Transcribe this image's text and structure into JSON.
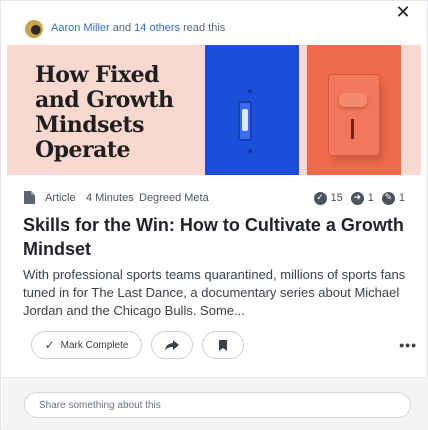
{
  "header": {
    "reader_name": "Aaron Miller",
    "reader_connector": "and",
    "others_link": "14 others",
    "read_suffix": "read this",
    "close_glyph": "✕"
  },
  "hero": {
    "lines": [
      "How Fixed",
      "and Growth",
      "Mindsets",
      "Operate"
    ]
  },
  "meta": {
    "content_type": "Article",
    "duration": "4 Minutes",
    "separator": "·",
    "provider": "Degreed Meta"
  },
  "stats": [
    {
      "icon": "completion-check-icon",
      "glyph": "✓",
      "value": "15"
    },
    {
      "icon": "share-count-icon",
      "glyph": "➜",
      "value": "1"
    },
    {
      "icon": "comment-count-icon",
      "glyph": "✎",
      "value": "1"
    }
  ],
  "article": {
    "title": "Skills for the Win: How to Cultivate a Growth Mindset",
    "summary": "With professional sports teams quarantined, millions of sports fans tuned in for The Last Dance, a documentary series about Michael Jordan and the Chicago Bulls. Some..."
  },
  "actions": {
    "mark_complete": "Mark Complete",
    "more_glyph": "•••"
  },
  "comment": {
    "placeholder": "Share something about this"
  },
  "colors": {
    "link": "#2f6fd6",
    "hero_bg": "#f8d8cf",
    "hero_blue": "#1b4fd9",
    "hero_red": "#ef6a4a"
  }
}
